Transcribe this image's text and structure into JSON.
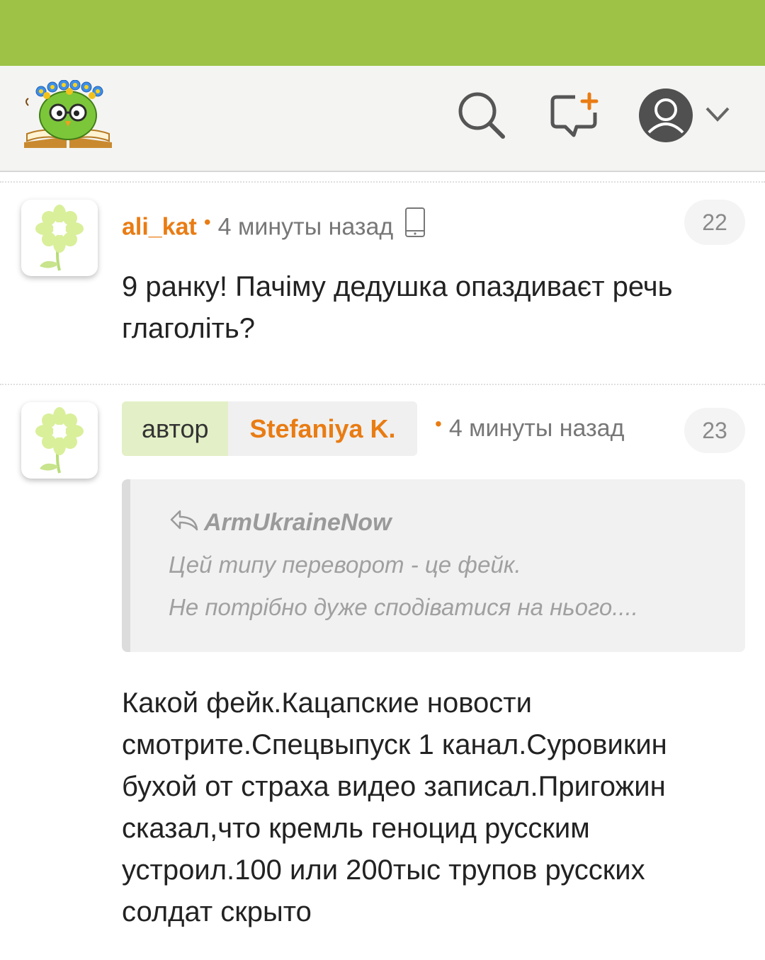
{
  "header": {
    "logo_icon": "owl-on-book-logo",
    "search_icon": "search-icon",
    "new_post_icon": "new-comment-icon",
    "account_icon": "user-avatar-icon",
    "menu_icon": "chevron-down-icon"
  },
  "comments": [
    {
      "avatar_icon": "flower-avatar-icon",
      "username": "ali_kat",
      "time": "4 минуты назад",
      "device_icon": "mobile-phone-icon",
      "counter": "22",
      "text_lines": [
        "9 ранку! Пачіму дедушка опаздиваєт речь",
        "глаголіть?"
      ]
    },
    {
      "avatar_icon": "flower-avatar-icon",
      "role": "автор",
      "username": "Stefaniya K.",
      "time": "4 минуты назад",
      "counter": "23",
      "quote": {
        "author": "ArmUkraineNow",
        "lines": [
          "Цей типу переворот - це фейк.",
          "Не потрібно дуже сподіватися на нього...."
        ]
      },
      "text_lines": [
        "Какой фейк.Кацапские новости",
        "смотрите.Спецвыпуск 1 канал.Суровикин",
        "бухой от страха видео записал.Пригожин",
        "сказал,что кремль геноцид русским",
        "устроил.100 или 200тыс трупов русских",
        "солдат скрыто"
      ]
    }
  ],
  "colors": {
    "status_bar": "#9dc246",
    "accent_orange": "#e97c13",
    "author_badge": "#e3efc6"
  }
}
